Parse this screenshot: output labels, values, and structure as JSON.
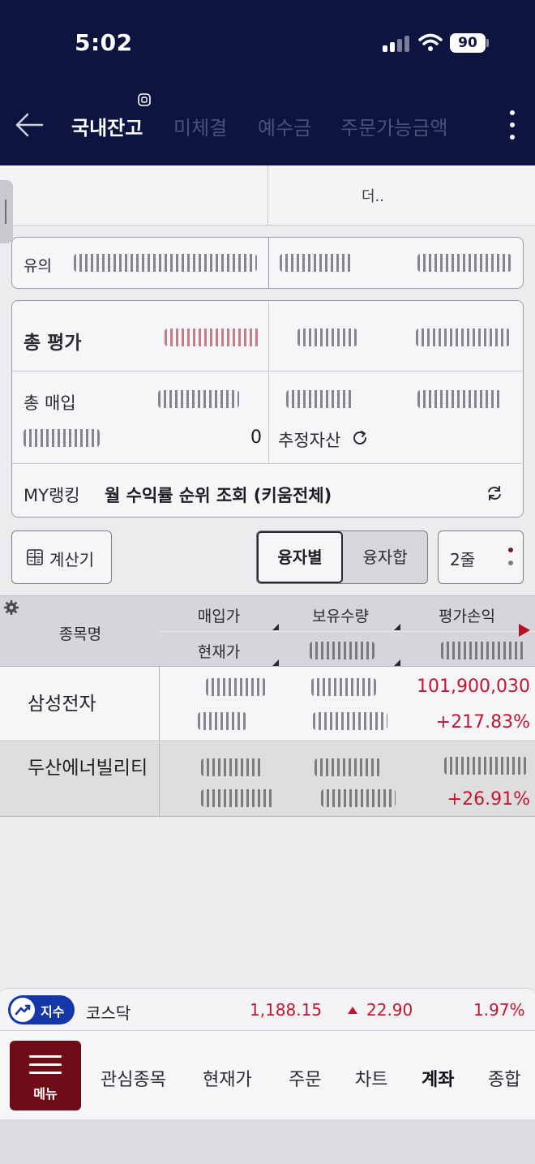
{
  "status": {
    "time": "5:02",
    "battery": "90"
  },
  "header": {
    "tabs": [
      {
        "label": "국내잔고",
        "active": true
      },
      {
        "label": "미체결",
        "active": false
      },
      {
        "label": "예수금",
        "active": false
      },
      {
        "label": "주문가능금액",
        "active": false
      }
    ]
  },
  "account": {
    "text": "더.."
  },
  "notice": {
    "label": "유의"
  },
  "summary": {
    "total_eval_label": "총 평가",
    "total_buy_label": "총 매입",
    "zero_value": "0",
    "estimated_assets_label": "추정자산",
    "my_ranking_label": "MY랭킹",
    "ranking_link": "월 수익률 순위 조회 (키움전체)"
  },
  "controls": {
    "calculator_label": "계산기",
    "segment_a": "융자별",
    "segment_b": "융자합",
    "lines_label": "2줄"
  },
  "table": {
    "headers": {
      "name": "종목명",
      "buy_price": "매입가",
      "quantity": "보유수량",
      "pnl": "평가손익",
      "current_price": "현재가"
    },
    "rows": [
      {
        "name": "삼성전자",
        "pnl": "101,900,030",
        "rate": "+217.83%"
      },
      {
        "name": "두산에너빌리티",
        "rate": "+26.91%"
      }
    ]
  },
  "ticker": {
    "badge": "지수",
    "name": "코스닥",
    "value": "1,188.15",
    "change": "22.90",
    "rate": "1.97%"
  },
  "bottom_nav": {
    "menu_label": "메뉴",
    "items": [
      {
        "label": "관심종목",
        "active": false
      },
      {
        "label": "현재가",
        "active": false
      },
      {
        "label": "주문",
        "active": false
      },
      {
        "label": "차트",
        "active": false
      },
      {
        "label": "계좌",
        "active": true
      },
      {
        "label": "종합",
        "active": false
      }
    ]
  },
  "colors": {
    "header_bg": "#0d1440",
    "up_red": "#c41530",
    "menu_bg": "#6e0d18",
    "index_blue": "#1538a8"
  }
}
